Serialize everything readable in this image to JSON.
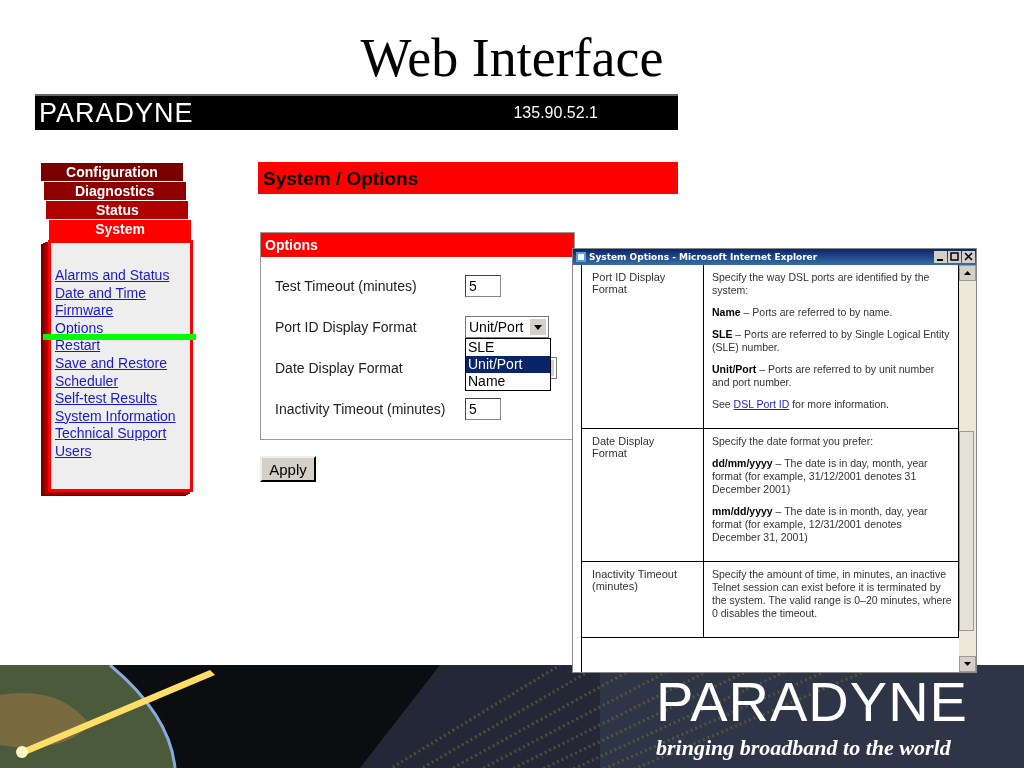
{
  "slide_title": "Web Interface",
  "header": {
    "logo": "PARADYNE",
    "ip_address": "135.90.52.1"
  },
  "nav_tabs": [
    {
      "label": "Configuration",
      "selected": false
    },
    {
      "label": "Diagnostics",
      "selected": false
    },
    {
      "label": "Status",
      "selected": false
    },
    {
      "label": "System",
      "selected": true
    }
  ],
  "nav_links": [
    {
      "label": "Alarms and Status",
      "marked": false
    },
    {
      "label": "Date and Time",
      "marked": false
    },
    {
      "label": "Firmware",
      "marked": false
    },
    {
      "label": "Options",
      "marked": true
    },
    {
      "label": "Restart",
      "marked": false
    },
    {
      "label": "Save and Restore",
      "marked": false
    },
    {
      "label": "Scheduler",
      "marked": false
    },
    {
      "label": "Self-test Results",
      "marked": false
    },
    {
      "label": "System Information",
      "marked": false
    },
    {
      "label": "Technical Support",
      "marked": false
    },
    {
      "label": "Users",
      "marked": false
    }
  ],
  "page_heading": "System / Options",
  "options_panel": {
    "title": "Options",
    "fields": [
      {
        "label": "Test Timeout (minutes)",
        "kind": "text",
        "value": "5"
      },
      {
        "label": "Port ID Display Format",
        "kind": "select",
        "value": "Unit/Port",
        "expanded": true,
        "options": [
          {
            "label": "SLE",
            "selected": false
          },
          {
            "label": "Unit/Port",
            "selected": true
          },
          {
            "label": "Name",
            "selected": false
          }
        ]
      },
      {
        "label": "Date Display Format",
        "kind": "select",
        "expanded": false
      },
      {
        "label": "Inactivity Timeout (minutes)",
        "kind": "text",
        "value": "5"
      }
    ]
  },
  "apply_button": "Apply",
  "help_window": {
    "title": "System Options - Microsoft Internet Explorer",
    "rows": [
      {
        "term": "Port ID Display Format",
        "paragraphs": [
          {
            "text": "Specify the way DSL ports are identified by the system:"
          },
          {
            "text": "**Name** – Ports are referred to by name."
          },
          {
            "text": "**SLE** – Ports are referred to by Single Logical Entity (SLE) number."
          },
          {
            "text": "**Unit/Port** – Ports are referred to by unit number and port number."
          },
          {
            "text": "See ",
            "link": "DSL Port ID",
            "after": " for more information."
          }
        ]
      },
      {
        "term": "Date Display Format",
        "paragraphs": [
          {
            "text": "Specify the date format you prefer:"
          },
          {
            "text": "**dd/mm/yyyy** – The date is in day, month, year format (for example, 31/12/2001 denotes 31 December 2001)"
          },
          {
            "text": "**mm/dd/yyyy** – The date is in month, day, year format (for example, 12/31/2001 denotes December 31, 2001)"
          }
        ]
      },
      {
        "term": "Inactivity Timeout (minutes)",
        "paragraphs": [
          {
            "text": "Specify the amount of time, in minutes, an inactive Telnet session can exist before it is terminated by the system. The valid range is 0–20 minutes, where 0 disables the timeout."
          }
        ]
      }
    ]
  },
  "banner": {
    "logo": "PARADYNE",
    "tagline": "bringing broadband to the world"
  }
}
